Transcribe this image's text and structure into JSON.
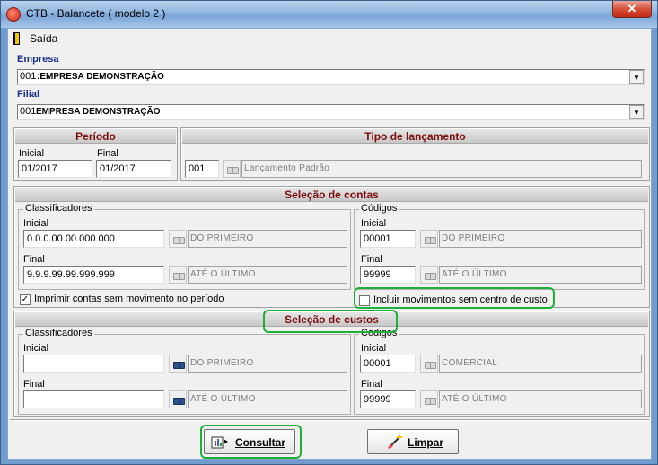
{
  "window": {
    "title": "CTB - Balancete ( modelo 2 )",
    "close_label": "✕"
  },
  "menu": {
    "exit_label": "Saída"
  },
  "empresa": {
    "label": "Empresa",
    "code": "001",
    "name": ":EMPRESA DEMONSTRAÇÃO"
  },
  "filial": {
    "label": "Filial",
    "code": "001",
    "name": "EMPRESA DEMONSTRAÇÃO"
  },
  "periodo": {
    "title": "Período",
    "initial_label": "Inicial",
    "initial_value": "01/2017",
    "final_label": "Final",
    "final_value": "01/2017"
  },
  "tipo": {
    "title": "Tipo de lançamento",
    "code": "001",
    "description": "Lançamento Padrão"
  },
  "contas": {
    "title": "Seleção de contas",
    "classificadores": {
      "legend": "Classificadores",
      "initial_label": "Inicial",
      "initial_value": "0.0.0.00.00.000.000",
      "initial_desc": "DO PRIMEIRO",
      "final_label": "Final",
      "final_value": "9.9.9.99.99.999.999",
      "final_desc": "ATÉ O ÚLTIMO"
    },
    "codigos": {
      "legend": "Códigos",
      "initial_label": "Inicial",
      "initial_value": "00001",
      "initial_desc": "DO PRIMEIRO",
      "final_label": "Final",
      "final_value": "99999",
      "final_desc": "ATÉ O ÚLTIMO"
    },
    "checkbox_label": "Imprimir contas sem movimento no período",
    "checkbox_checked": true,
    "checkbox2_label": "Incluir movimentos sem centro de custo",
    "checkbox2_checked": false
  },
  "custos": {
    "title": "Seleção de custos",
    "classificadores": {
      "legend": "Classificadores",
      "initial_label": "Inicial",
      "initial_value": "",
      "initial_desc": "DO PRIMEIRO",
      "final_label": "Final",
      "final_value": "",
      "final_desc": "ATÉ O ÚLTIMO"
    },
    "codigos": {
      "legend": "Códigos",
      "initial_label": "Inicial",
      "initial_value": "00001",
      "initial_desc": "COMERCIAL",
      "final_label": "Final",
      "final_value": "99999",
      "final_desc": "ATÉ O ÚLTIMO"
    }
  },
  "buttons": {
    "consultar": "Consultar",
    "limpar": "Limpar"
  }
}
